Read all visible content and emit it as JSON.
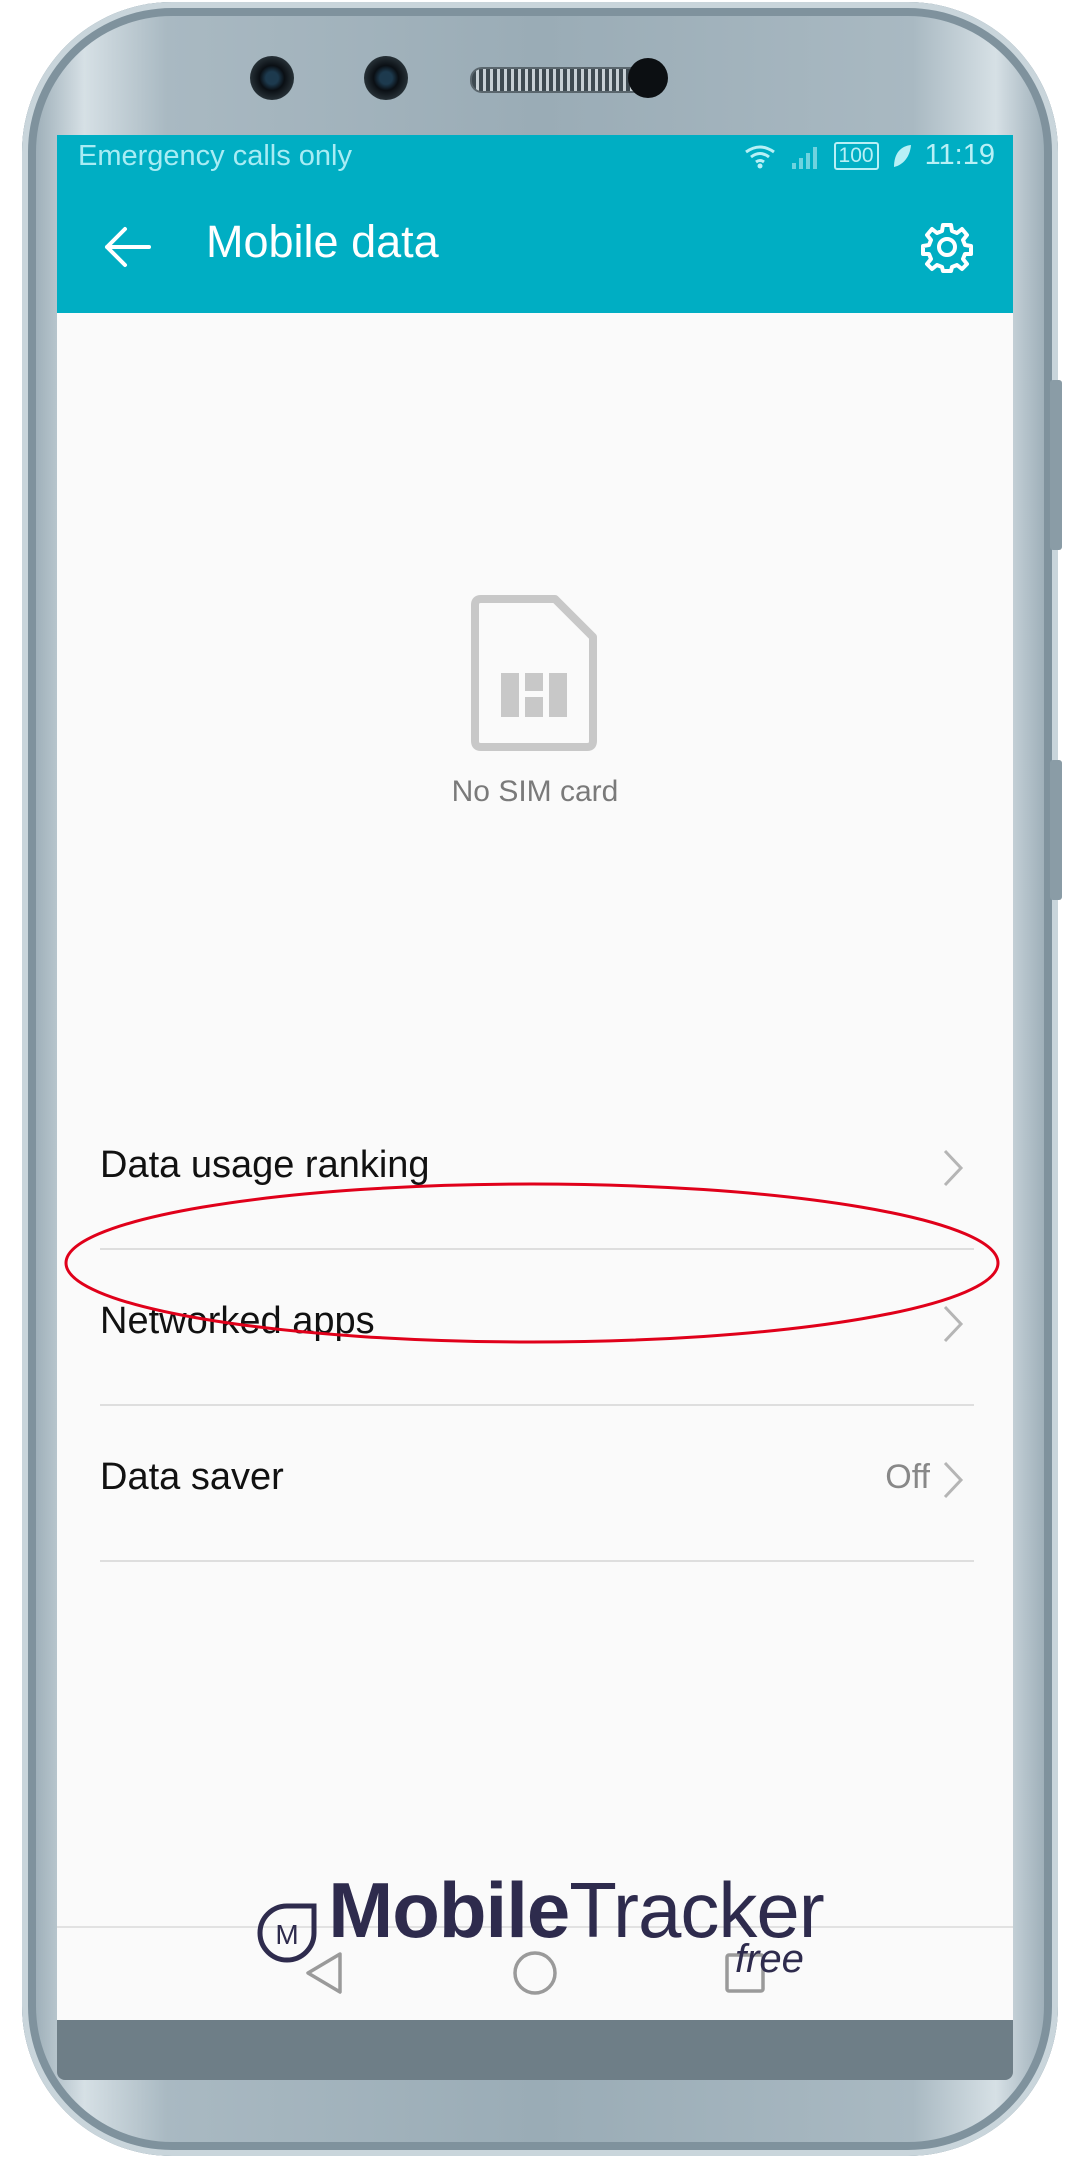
{
  "status_bar": {
    "carrier_text": "Emergency calls only",
    "battery_level": "100",
    "time": "11:19"
  },
  "app_bar": {
    "title": "Mobile data"
  },
  "sim": {
    "label": "No SIM card"
  },
  "menu": {
    "items": [
      {
        "label": "Data usage ranking",
        "value": ""
      },
      {
        "label": "Networked apps",
        "value": ""
      },
      {
        "label": "Data saver",
        "value": "Off"
      }
    ]
  },
  "watermark": {
    "brand_bold": "Mobile",
    "brand_thin": "Tracker",
    "free": "free"
  },
  "colors": {
    "accent": "#00aec3",
    "highlight": "#e0001a"
  }
}
